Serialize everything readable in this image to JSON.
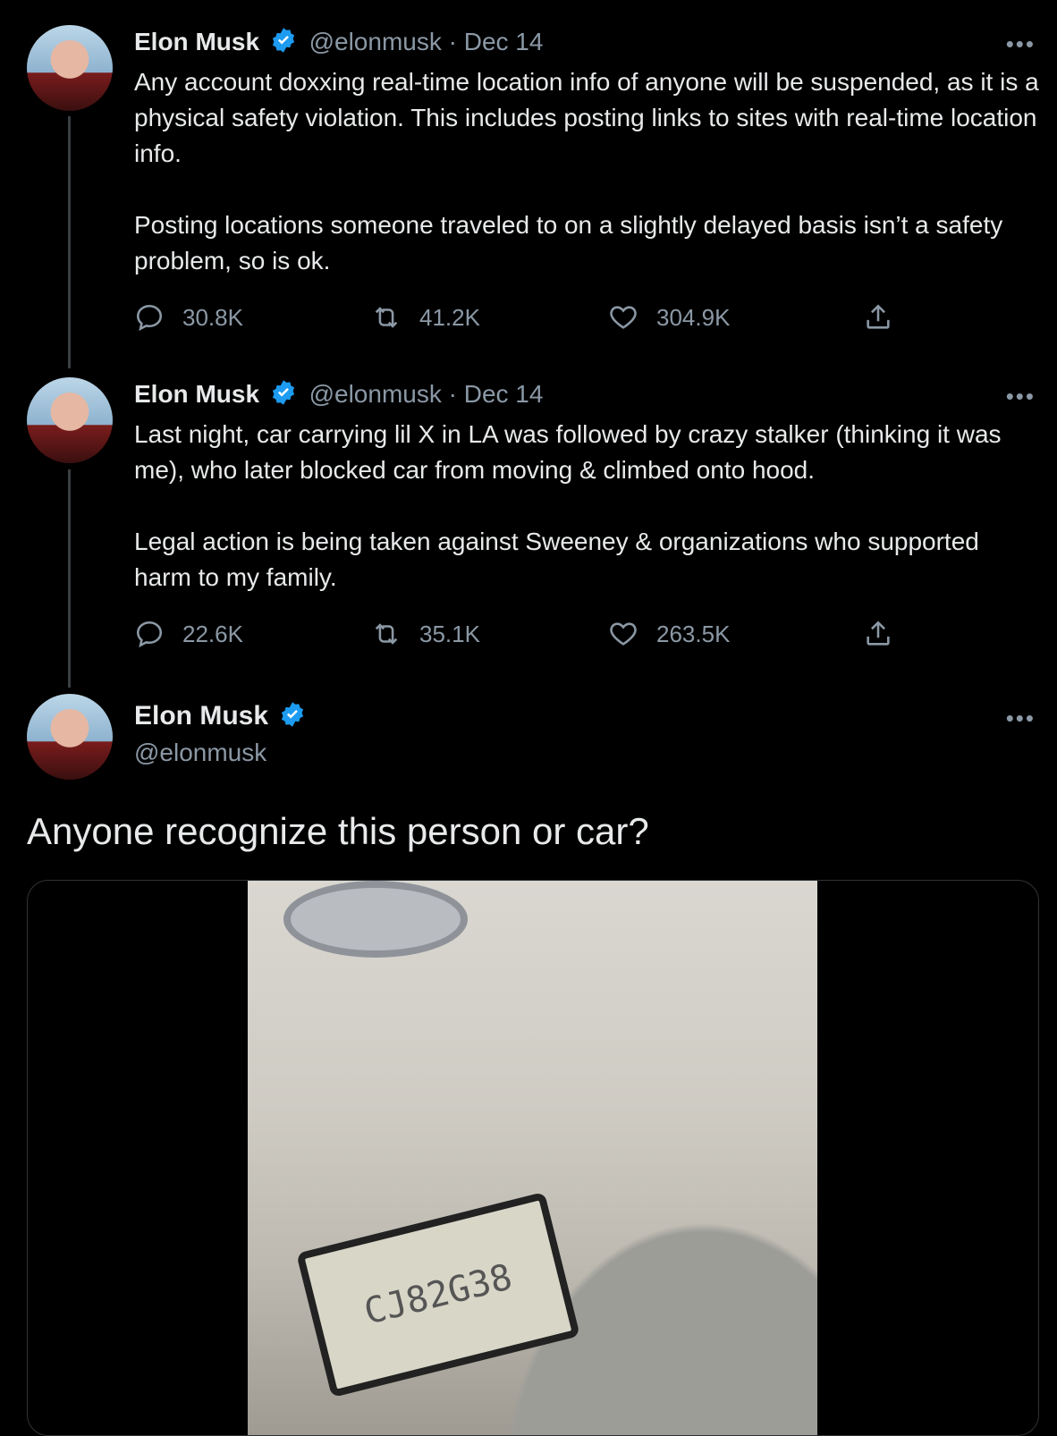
{
  "tweets": [
    {
      "name": "Elon Musk",
      "handle": "@elonmusk",
      "separator": "·",
      "date": "Dec 14",
      "paragraphs": [
        "Any account doxxing real-time location info of anyone will be suspended, as it is a physical safety violation. This includes posting links to sites with real-time location info.",
        "Posting locations someone traveled to on a slightly delayed basis isn’t a safety problem, so is ok."
      ],
      "replies": "30.8K",
      "retweets": "41.2K",
      "likes": "304.9K"
    },
    {
      "name": "Elon Musk",
      "handle": "@elonmusk",
      "separator": "·",
      "date": "Dec 14",
      "paragraphs": [
        "Last night, car carrying lil X in LA was followed by crazy stalker (thinking it was me), who later blocked car from moving & climbed onto hood.",
        "Legal action is being taken against Sweeney & organizations who supported harm to my family."
      ],
      "replies": "22.6K",
      "retweets": "35.1K",
      "likes": "263.5K"
    }
  ],
  "main_tweet": {
    "name": "Elon Musk",
    "handle": "@elonmusk",
    "text": "Anyone recognize this person or car?",
    "plate_text": "CJ82G38"
  },
  "more_label": "•••",
  "colors": {
    "background": "#000000",
    "secondary": "#8b98a5",
    "verified": "#1d9bf0"
  }
}
